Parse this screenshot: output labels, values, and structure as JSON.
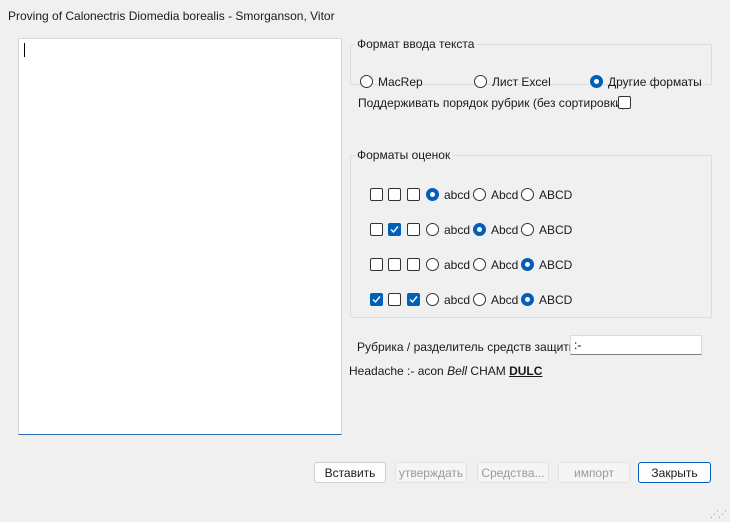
{
  "window": {
    "title": "Proving of Calonectris Diomedia borealis - Smorganson, Vitor"
  },
  "input_format": {
    "title": "Формат ввода текста",
    "options": [
      {
        "label": "MacRep",
        "selected": false
      },
      {
        "label": "Лист Excel",
        "selected": false
      },
      {
        "label": "Другие форматы",
        "selected": true
      }
    ]
  },
  "keep_order": {
    "label": "Поддерживать порядок рубрик (без сортировки)",
    "checked": false
  },
  "score_formats": {
    "title": "Форматы оценок",
    "case_labels": [
      "abcd",
      "Abcd",
      "ABCD"
    ],
    "rows": [
      {
        "checks": [
          false,
          false,
          false
        ],
        "case": 0
      },
      {
        "checks": [
          false,
          true,
          false
        ],
        "case": 1
      },
      {
        "checks": [
          false,
          false,
          false
        ],
        "case": 2
      },
      {
        "checks": [
          true,
          false,
          true
        ],
        "case": 2
      }
    ]
  },
  "separator": {
    "label": "Рубрика / разделитель средств защиты",
    "value": ":-"
  },
  "preview": {
    "part1": "Headache :- acon ",
    "italic": "Bell",
    "part2": " CHAM ",
    "bold": "DULC"
  },
  "buttons": {
    "insert": "Вставить",
    "confirm": "утверждать",
    "remedies": "Средства...",
    "import": "импорт",
    "close": "Закрыть"
  },
  "colors": {
    "accent": "#005fb8",
    "background": "#f0f0f0"
  }
}
